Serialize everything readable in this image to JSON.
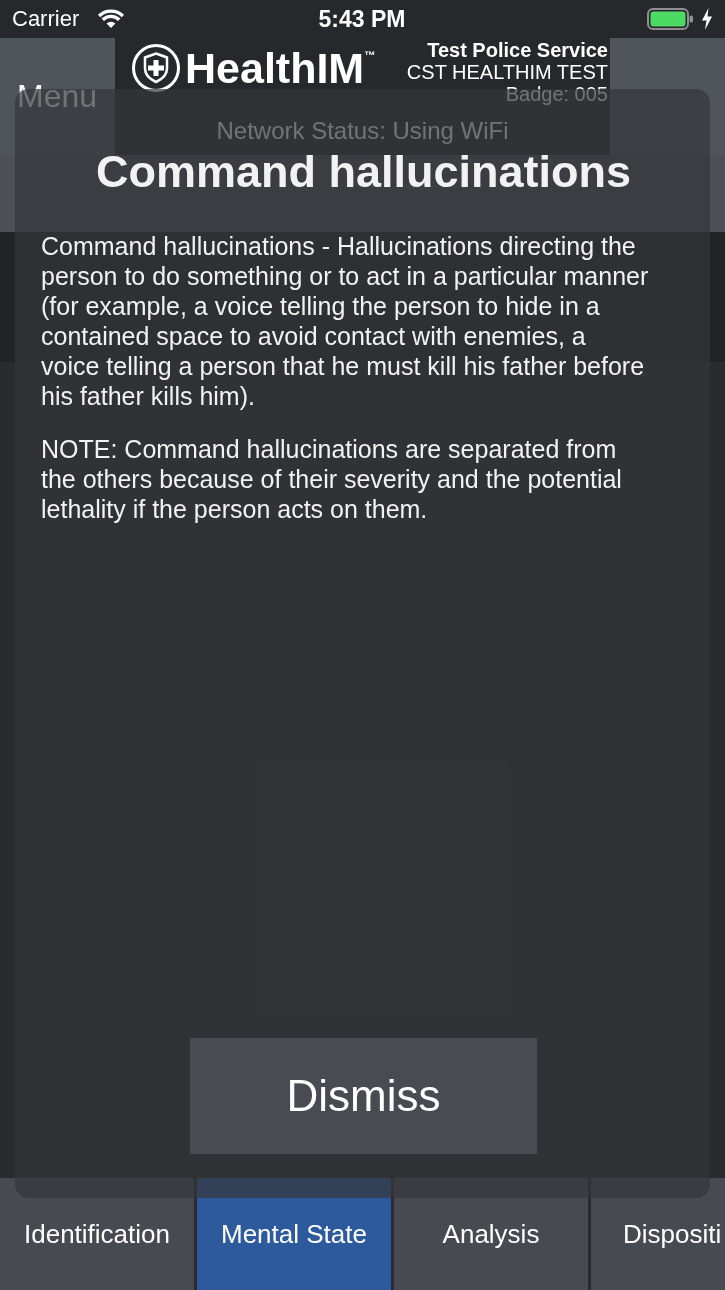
{
  "status_bar": {
    "carrier": "Carrier",
    "time": "5:43 PM",
    "charging": true
  },
  "header": {
    "menu_button": "Menu",
    "brand": "HealthIM$^{™}$",
    "service": "Test Police Service",
    "unit": "CST HEALTHIM TEST",
    "badge": "Badge: 005",
    "network_status": "Network Status: Using WiFi"
  },
  "modal": {
    "title": "Command hallucinations",
    "paragraphs": [
      "Command hallucinations - Hallucinations directing the person to do something or to act in a particular manner (for example, a voice telling the person to hide in a contained space to avoid contact with enemies, a voice telling a person that he must kill his father before his father kills him).",
      "NOTE: Command hallucinations are separated from the others because of their severity and the potential lethality if the person acts on them."
    ],
    "button": "Dismiss"
  },
  "tabs": [
    {
      "label": "Identification",
      "selected": false
    },
    {
      "label": "Mental State",
      "selected": true
    },
    {
      "label": "Analysis",
      "selected": false
    },
    {
      "label": "Dispositi",
      "selected": false
    }
  ]
}
